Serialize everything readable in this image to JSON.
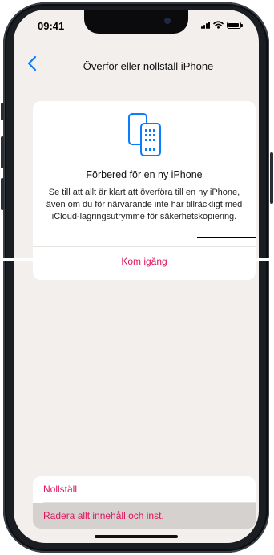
{
  "status_bar": {
    "time": "09:41",
    "battery_level": 0.9
  },
  "nav": {
    "back_icon": "chevron-left-icon",
    "title": "Överför eller nollställ iPhone"
  },
  "card": {
    "icon": "two-phones-icon",
    "title": "Förbered för en ny iPhone",
    "description": "Se till att allt är klart att överföra till en ny iPhone, även om du för närvarande inte har tillräckligt med iCloud-lagringsutrymme för säkerhetskopiering.",
    "action_label": "Kom igång"
  },
  "bottom_list": {
    "items": [
      {
        "label": "Nollställ",
        "selected": false
      },
      {
        "label": "Radera allt innehåll och inst.",
        "selected": true
      }
    ]
  },
  "colors": {
    "accent": "#e0145f",
    "back": "#0a7cff",
    "background": "#f2efed"
  }
}
